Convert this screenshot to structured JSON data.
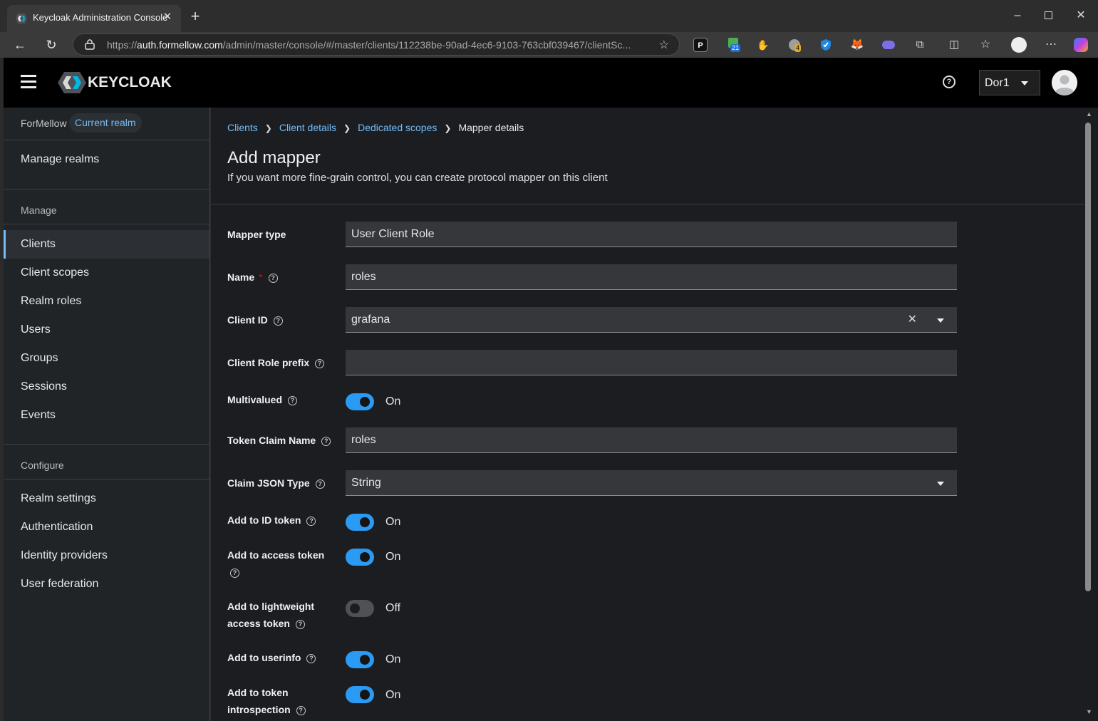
{
  "browser": {
    "tab_title": "Keycloak Administration Console",
    "url_prefix": "https://",
    "url_host": "auth.formellow.com",
    "url_path": "/admin/master/console/#/master/clients/112238be-90ad-4ec6-9103-763cbf039467/clientSc...",
    "ext_badges": {
      "calendar": "21",
      "gear": "4"
    }
  },
  "header": {
    "logo_text": "KEYCLOAK",
    "user_name": "Dor1"
  },
  "sidebar": {
    "realm_name": "ForMellow",
    "realm_badge": "Current realm",
    "manage_realms": "Manage realms",
    "manage_section": "Manage",
    "manage_items": [
      {
        "label": "Clients",
        "active": true
      },
      {
        "label": "Client scopes"
      },
      {
        "label": "Realm roles"
      },
      {
        "label": "Users"
      },
      {
        "label": "Groups"
      },
      {
        "label": "Sessions"
      },
      {
        "label": "Events"
      }
    ],
    "configure_section": "Configure",
    "configure_items": [
      {
        "label": "Realm settings"
      },
      {
        "label": "Authentication"
      },
      {
        "label": "Identity providers"
      },
      {
        "label": "User federation"
      }
    ]
  },
  "main": {
    "breadcrumb": [
      "Clients",
      "Client details",
      "Dedicated scopes",
      "Mapper details"
    ],
    "title": "Add mapper",
    "description": "If you want more fine-grain control, you can create protocol mapper on this client",
    "fields": {
      "mapper_type": {
        "label": "Mapper type",
        "value": "User Client Role"
      },
      "name": {
        "label": "Name",
        "required": "*",
        "value": "roles"
      },
      "client_id": {
        "label": "Client ID",
        "value": "grafana"
      },
      "client_role_prefix": {
        "label": "Client Role prefix",
        "value": ""
      },
      "multivalued": {
        "label": "Multivalued",
        "state": "On"
      },
      "token_claim_name": {
        "label": "Token Claim Name",
        "value": "roles"
      },
      "claim_json_type": {
        "label": "Claim JSON Type",
        "value": "String"
      },
      "add_to_id_token": {
        "label": "Add to ID token",
        "state": "On"
      },
      "add_to_access_token": {
        "label": "Add to access token",
        "state": "On"
      },
      "add_to_lightweight": {
        "label_line1": "Add to lightweight",
        "label_line2": "access token",
        "state": "Off"
      },
      "add_to_userinfo": {
        "label": "Add to userinfo",
        "state": "On"
      },
      "add_to_introspection": {
        "label_line1": "Add to token",
        "label_line2": "introspection",
        "state": "On"
      }
    }
  },
  "colors": {
    "accent": "#73bcf7",
    "toggle_on": "#2b9af3",
    "required": "#c9190b"
  }
}
